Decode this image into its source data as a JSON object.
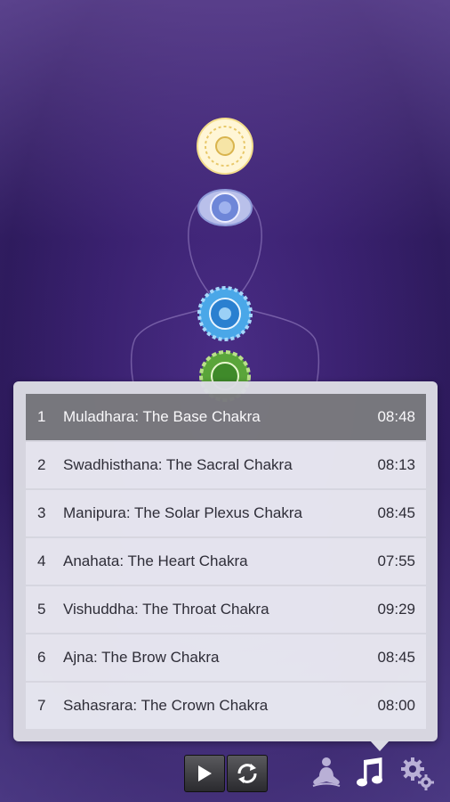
{
  "tracks": [
    {
      "num": "1",
      "title": "Muladhara: The Base Chakra",
      "duration": "08:48",
      "selected": true
    },
    {
      "num": "2",
      "title": "Swadhisthana: The Sacral Chakra",
      "duration": "08:13"
    },
    {
      "num": "3",
      "title": "Manipura: The Solar Plexus Chakra",
      "duration": "08:45"
    },
    {
      "num": "4",
      "title": "Anahata: The Heart Chakra",
      "duration": "07:55"
    },
    {
      "num": "5",
      "title": "Vishuddha: The Throat Chakra",
      "duration": "09:29"
    },
    {
      "num": "6",
      "title": "Ajna: The Brow Chakra",
      "duration": "08:45"
    },
    {
      "num": "7",
      "title": "Sahasrara: The Crown Chakra",
      "duration": "08:00"
    }
  ],
  "controls": {
    "play_icon": "play-icon",
    "repeat_icon": "repeat-icon"
  },
  "nav": {
    "meditation_icon": "meditation-icon",
    "music_icon": "music-note-icon",
    "settings_icon": "gear-icon"
  },
  "colors": {
    "background": "#3a2170",
    "selected_row": "#7a7a7e",
    "panel": "#dcdce4"
  }
}
